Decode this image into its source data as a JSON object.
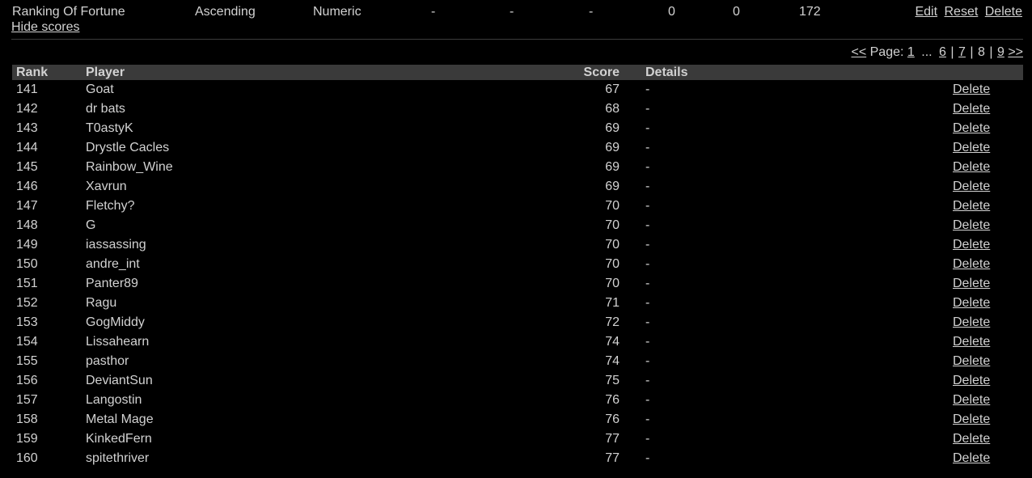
{
  "summary": {
    "name": "Ranking Of Fortune",
    "order": "Ascending",
    "type": "Numeric",
    "col4": "-",
    "col5": "-",
    "col6": "-",
    "col7": "0",
    "col8": "0",
    "count": "172",
    "edit": "Edit",
    "reset": "Reset",
    "delete": "Delete",
    "hide_scores": "Hide scores"
  },
  "pager": {
    "prev": "<<",
    "page_label": "Page:",
    "first": "1",
    "ellipsis": "...",
    "p6": "6",
    "p7": "7",
    "current": "8",
    "p9": "9",
    "next": ">>",
    "sep": "|"
  },
  "table": {
    "headers": {
      "rank": "Rank",
      "player": "Player",
      "score": "Score",
      "details": "Details"
    },
    "delete_label": "Delete",
    "rows": [
      {
        "rank": "141",
        "player": "Goat",
        "score": "67",
        "details": "-"
      },
      {
        "rank": "142",
        "player": "dr bats",
        "score": "68",
        "details": "-"
      },
      {
        "rank": "143",
        "player": "T0astyK",
        "score": "69",
        "details": "-"
      },
      {
        "rank": "144",
        "player": "Drystle Cacles",
        "score": "69",
        "details": "-"
      },
      {
        "rank": "145",
        "player": "Rainbow_Wine",
        "score": "69",
        "details": "-"
      },
      {
        "rank": "146",
        "player": "Xavrun",
        "score": "69",
        "details": "-"
      },
      {
        "rank": "147",
        "player": "Fletchy?",
        "score": "70",
        "details": "-"
      },
      {
        "rank": "148",
        "player": "G",
        "score": "70",
        "details": "-"
      },
      {
        "rank": "149",
        "player": "iassassing",
        "score": "70",
        "details": "-"
      },
      {
        "rank": "150",
        "player": "andre_int",
        "score": "70",
        "details": "-"
      },
      {
        "rank": "151",
        "player": "Panter89",
        "score": "70",
        "details": "-"
      },
      {
        "rank": "152",
        "player": "Ragu",
        "score": "71",
        "details": "-"
      },
      {
        "rank": "153",
        "player": "GogMiddy",
        "score": "72",
        "details": "-"
      },
      {
        "rank": "154",
        "player": "Lissahearn",
        "score": "74",
        "details": "-"
      },
      {
        "rank": "155",
        "player": "pasthor",
        "score": "74",
        "details": "-"
      },
      {
        "rank": "156",
        "player": "DeviantSun",
        "score": "75",
        "details": "-"
      },
      {
        "rank": "157",
        "player": "Langostin",
        "score": "76",
        "details": "-"
      },
      {
        "rank": "158",
        "player": "Metal Mage",
        "score": "76",
        "details": "-"
      },
      {
        "rank": "159",
        "player": "KinkedFern",
        "score": "77",
        "details": "-"
      },
      {
        "rank": "160",
        "player": "spitethriver",
        "score": "77",
        "details": "-"
      }
    ]
  }
}
